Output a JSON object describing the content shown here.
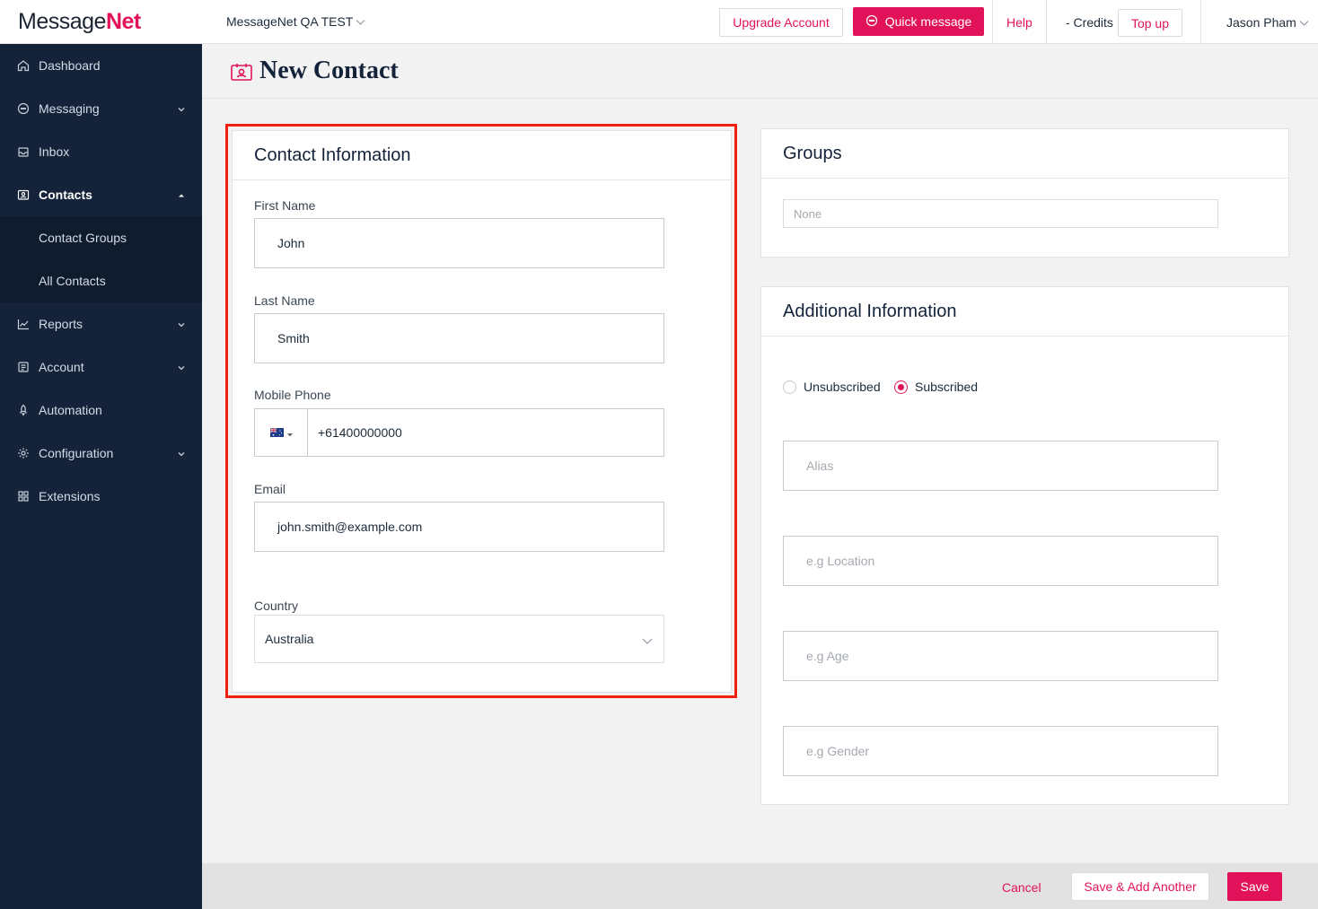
{
  "app": {
    "logo_main": "Message",
    "logo_accent": "Net"
  },
  "topbar": {
    "account_name": "MessageNet QA TEST",
    "upgrade_label": "Upgrade Account",
    "quick_message_label": "Quick message",
    "help_label": "Help",
    "credits_label": "- Credits",
    "topup_label": "Top up",
    "user_name": "Jason Pham"
  },
  "sidebar": {
    "items": [
      {
        "label": "Dashboard",
        "icon": "home-icon"
      },
      {
        "label": "Messaging",
        "icon": "chat-icon"
      },
      {
        "label": "Inbox",
        "icon": "inbox-icon"
      },
      {
        "label": "Contacts",
        "icon": "contacts-icon"
      },
      {
        "label": "Reports",
        "icon": "chart-icon"
      },
      {
        "label": "Account",
        "icon": "account-icon"
      },
      {
        "label": "Automation",
        "icon": "rocket-icon"
      },
      {
        "label": "Configuration",
        "icon": "gear-icon"
      },
      {
        "label": "Extensions",
        "icon": "grid-icon"
      }
    ],
    "contacts_sub": [
      "Contact Groups",
      "All Contacts"
    ]
  },
  "page": {
    "title": "New Contact"
  },
  "contact_info": {
    "title": "Contact Information",
    "first_name_label": "First Name",
    "first_name_value": "John",
    "last_name_label": "Last Name",
    "last_name_value": "Smith",
    "mobile_label": "Mobile Phone",
    "mobile_value": "+61400000000",
    "email_label": "Email",
    "email_value": "john.smith@example.com",
    "country_label": "Country",
    "country_value": "Australia"
  },
  "groups": {
    "title": "Groups",
    "placeholder": "None"
  },
  "additional": {
    "title": "Additional Information",
    "unsubscribed_label": "Unsubscribed",
    "subscribed_label": "Subscribed",
    "subscription_selected": "Subscribed",
    "alias_placeholder": "Alias",
    "location_placeholder": "e.g Location",
    "age_placeholder": "e.g Age",
    "gender_placeholder": "e.g Gender"
  },
  "footer": {
    "cancel_label": "Cancel",
    "save_add_label": "Save & Add Another",
    "save_label": "Save"
  },
  "colors": {
    "accent": "#e2125a",
    "sidebar": "#14233a",
    "highlight": "#f0200f"
  }
}
